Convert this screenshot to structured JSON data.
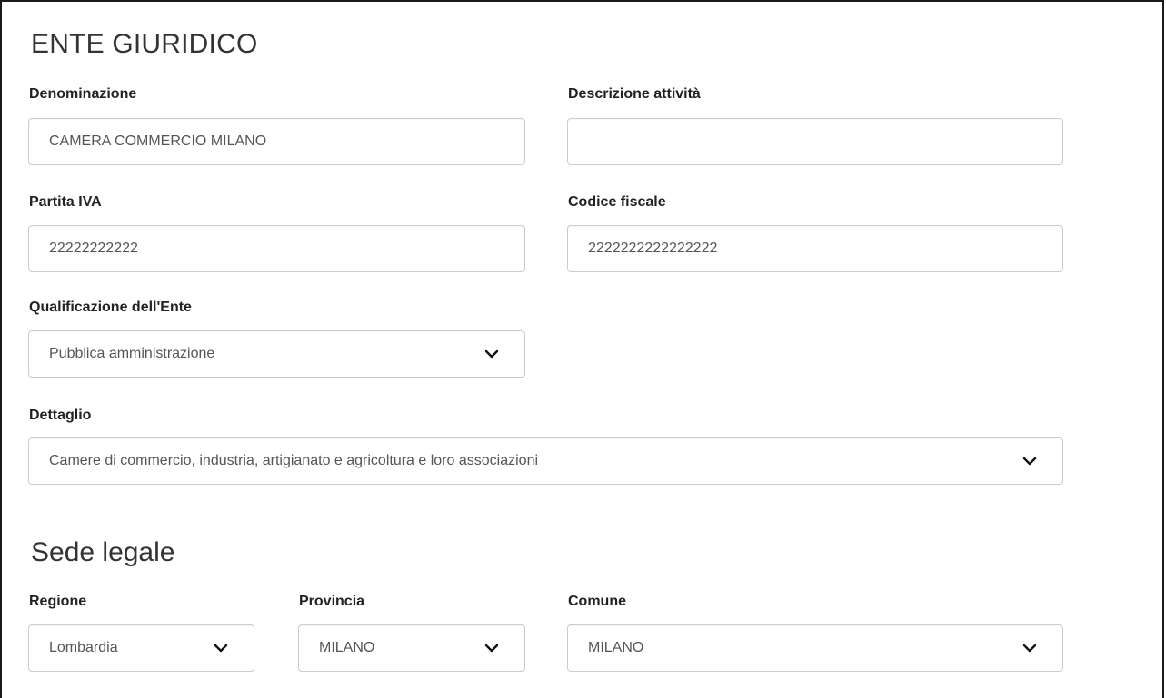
{
  "ente": {
    "title": "ENTE GIURIDICO",
    "denominazione": {
      "label": "Denominazione",
      "value": "CAMERA COMMERCIO MILANO"
    },
    "descrizione": {
      "label": "Descrizione attività",
      "value": ""
    },
    "partita_iva": {
      "label": "Partita IVA",
      "value": "22222222222"
    },
    "codice_fiscale": {
      "label": "Codice fiscale",
      "value": "2222222222222222"
    },
    "qualificazione": {
      "label": "Qualificazione dell'Ente",
      "selected": "Pubblica amministrazione"
    },
    "dettaglio": {
      "label": "Dettaglio",
      "selected": "Camere di commercio, industria, artigianato e agricoltura e loro associazioni"
    }
  },
  "sede": {
    "title": "Sede legale",
    "regione": {
      "label": "Regione",
      "selected": "Lombardia"
    },
    "provincia": {
      "label": "Provincia",
      "selected": "MILANO"
    },
    "comune": {
      "label": "Comune",
      "selected": "MILANO"
    }
  },
  "icons": {
    "dropdown": "chevron-down-icon"
  }
}
